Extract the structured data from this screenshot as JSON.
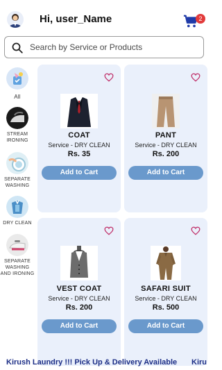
{
  "header": {
    "greeting": "Hi, user_Name",
    "cart_count": "2",
    "accent": "#1f3aa8",
    "badge_color": "#e23b3b"
  },
  "search": {
    "placeholder": "Search by Service or Products"
  },
  "categories": [
    {
      "label": "All",
      "icon": "all-services-icon"
    },
    {
      "label": "STREAM IRONING",
      "icon": "iron-icon"
    },
    {
      "label": "SEPARATE WASHING",
      "icon": "washing-icon"
    },
    {
      "label": "DRY CLEAN",
      "icon": "dry-clean-icon"
    },
    {
      "label": "SEPARATE WASHING AND IRONING",
      "icon": "washing-ironing-icon"
    }
  ],
  "products": [
    {
      "name": "COAT",
      "service": "Service - DRY CLEAN",
      "price": "Rs. 35",
      "button": "Add to Cart",
      "image": "coat-image"
    },
    {
      "name": "PANT",
      "service": "Service - DRY CLEAN",
      "price": "Rs. 200",
      "button": "Add to Cart",
      "image": "pant-image"
    },
    {
      "name": "VEST COAT",
      "service": "Service - DRY CLEAN",
      "price": "Rs. 200",
      "button": "Add to Cart",
      "image": "vest-image"
    },
    {
      "name": "SAFARI SUIT",
      "service": "Service - DRY CLEAN",
      "price": "Rs. 500",
      "button": "Add to Cart",
      "image": "safari-suit-image"
    }
  ],
  "ticker": {
    "text": "Kirush Laundry !!! Pick Up & Delivery Available",
    "text_repeat": "Kiru"
  },
  "colors": {
    "button": "#6a99cc",
    "card": "#eaf0fb",
    "heart": "#c0306a"
  }
}
